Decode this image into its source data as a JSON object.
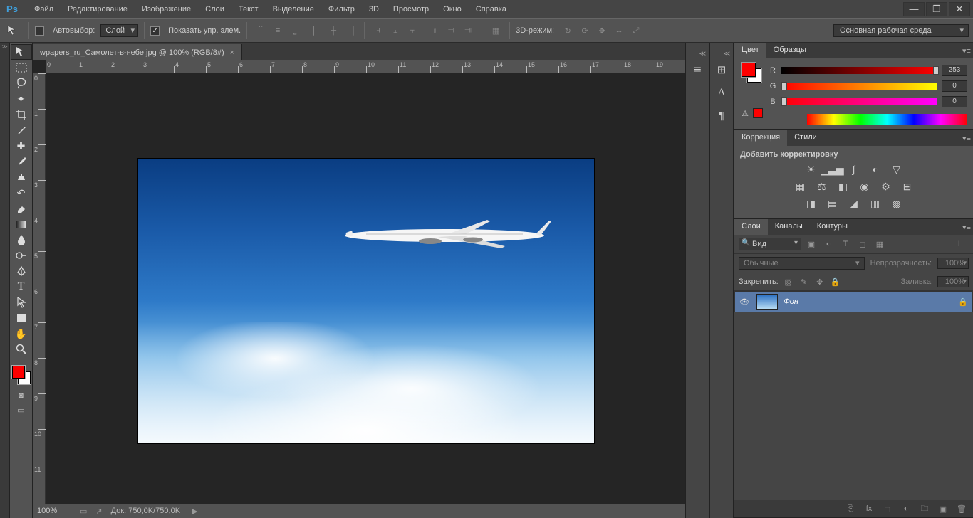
{
  "app": {
    "logo": "Ps"
  },
  "menu": {
    "file": "Файл",
    "edit": "Редактирование",
    "image": "Изображение",
    "layer": "Слои",
    "type": "Текст",
    "select": "Выделение",
    "filter": "Фильтр",
    "threeD": "3D",
    "view": "Просмотр",
    "window": "Окно",
    "help": "Справка"
  },
  "options": {
    "autoSelect": "Автовыбор:",
    "autoSelectTarget": "Слой",
    "showTransform": "Показать упр. элем.",
    "mode3d": "3D-режим:"
  },
  "workspace": {
    "selected": "Основная рабочая среда"
  },
  "document": {
    "tab": "wpapers_ru_Самолет-в-небе.jpg @ 100% (RGB/8#)",
    "zoom": "100%",
    "info": "Док: 750,0K/750,0K"
  },
  "ruler": {
    "h": [
      "0",
      "1",
      "2",
      "3",
      "4",
      "5",
      "6",
      "7",
      "8",
      "9",
      "10",
      "11",
      "12",
      "13",
      "14",
      "15",
      "16",
      "17",
      "18",
      "19"
    ],
    "v": [
      "0",
      "1",
      "2",
      "3",
      "4",
      "5",
      "6",
      "7",
      "8",
      "9",
      "10",
      "11"
    ]
  },
  "panels": {
    "color": {
      "tab1": "Цвет",
      "tab2": "Образцы",
      "r": {
        "label": "R",
        "value": "253"
      },
      "g": {
        "label": "G",
        "value": "0"
      },
      "b": {
        "label": "B",
        "value": "0"
      }
    },
    "adjust": {
      "tab1": "Коррекция",
      "tab2": "Стили",
      "heading": "Добавить корректировку"
    },
    "layers": {
      "tab1": "Слои",
      "tab2": "Каналы",
      "tab3": "Контуры",
      "filterKind": "Вид",
      "blend": "Обычные",
      "opacityLabel": "Непрозрачность:",
      "opacityValue": "100%",
      "lockLabel": "Закрепить:",
      "fillLabel": "Заливка:",
      "fillValue": "100%",
      "layerName": "Фон"
    }
  }
}
